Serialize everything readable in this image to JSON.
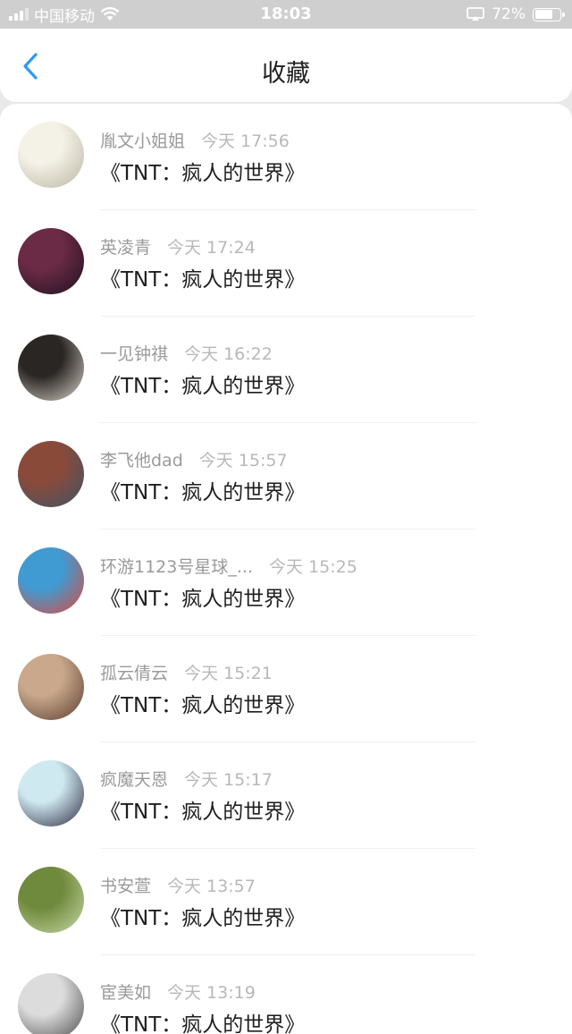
{
  "status_bar": {
    "carrier": "中国移动",
    "time": "18:03",
    "battery": "72%",
    "battery_level": 0.72
  },
  "header": {
    "title": "收藏"
  },
  "items": [
    {
      "name": "胤文小姐姐",
      "time": "今天 17:56",
      "book": "《TNT：疯人的世界》",
      "avatar_colors": [
        "#f4f1e6",
        "#b9b6a3"
      ]
    },
    {
      "name": "英凌青",
      "time": "今天 17:24",
      "book": "《TNT：疯人的世界》",
      "avatar_colors": [
        "#6b2a45",
        "#1e1220"
      ]
    },
    {
      "name": "一见钟祺",
      "time": "今天 16:22",
      "book": "《TNT：疯人的世界》",
      "avatar_colors": [
        "#2a2624",
        "#d9d3c9"
      ]
    },
    {
      "name": "李飞他dad",
      "time": "今天 15:57",
      "book": "《TNT：疯人的世界》",
      "avatar_colors": [
        "#8a4a3a",
        "#3d5566"
      ]
    },
    {
      "name": "环游1123号星球_...",
      "time": "今天 15:25",
      "book": "《TNT：疯人的世界》",
      "avatar_colors": [
        "#3f9bd2",
        "#e0483a"
      ]
    },
    {
      "name": "孤云倩云",
      "time": "今天 15:21",
      "book": "《TNT：疯人的世界》",
      "avatar_colors": [
        "#c9a88b",
        "#5a3d30"
      ]
    },
    {
      "name": "疯魔天恩",
      "time": "今天 15:17",
      "book": "《TNT：疯人的世界》",
      "avatar_colors": [
        "#cfe9f0",
        "#2c2a40"
      ]
    },
    {
      "name": "书安萱",
      "time": "今天 13:57",
      "book": "《TNT：疯人的世界》",
      "avatar_colors": [
        "#6f8a3c",
        "#c7d8a8"
      ]
    },
    {
      "name": "宦美如",
      "time": "今天 13:19",
      "book": "《TNT：疯人的世界》",
      "avatar_colors": [
        "#dcdcdc",
        "#4b4b4b"
      ]
    }
  ]
}
